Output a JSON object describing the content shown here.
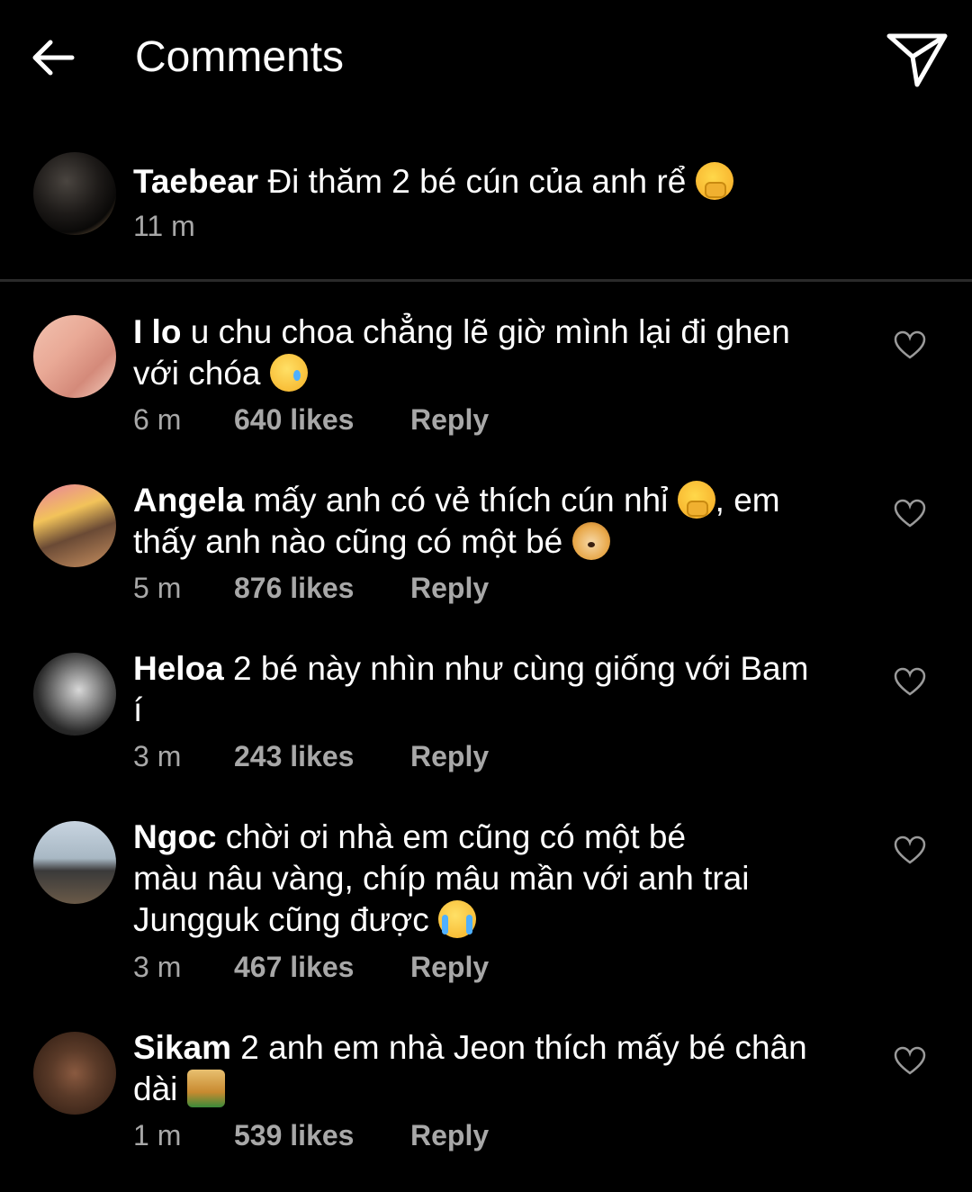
{
  "header": {
    "title": "Comments"
  },
  "caption": {
    "username": "Taebear",
    "text": "Đi thăm 2 bé cún của anh rể",
    "time": "11 m"
  },
  "comments": [
    {
      "username": "I lo",
      "text_line1": "u chu choa chẳng lẽ giờ mình lại đi ghen",
      "text_line2": "với chóa",
      "time": "6 m",
      "likes": "640 likes",
      "reply": "Reply"
    },
    {
      "username": "Angela",
      "text_line1": "mấy anh có vẻ thích cún nhỉ",
      "text_line1b": ", em",
      "text_line2": "thấy anh nào cũng có một bé",
      "time": "5 m",
      "likes": "876 likes",
      "reply": "Reply"
    },
    {
      "username": "Heloa",
      "text_line1": "2 bé này nhìn như cùng giống với Bam",
      "text_line2": "í",
      "time": "3 m",
      "likes": "243 likes",
      "reply": "Reply"
    },
    {
      "username": "Ngoc",
      "text_line1": "chời ơi nhà em cũng có một bé",
      "text_line2": "màu nâu vàng, chíp mâu mần với anh trai",
      "text_line3": "Jungguk cũng được",
      "time": "3 m",
      "likes": "467 likes",
      "reply": "Reply"
    },
    {
      "username": "Sikam",
      "text_line1": "2 anh em nhà Jeon thích mấy bé chân",
      "text_line2": "dài",
      "time": "1 m",
      "likes": "539 likes",
      "reply": "Reply"
    }
  ],
  "icons": [
    "back-arrow-icon",
    "send-icon",
    "heart-icon",
    "emoji-shy-icon",
    "emoji-tear-smile-icon",
    "emoji-dog-icon",
    "emoji-crying-icon",
    "emoji-guide-dog-icon"
  ],
  "colors": {
    "background": "#000000",
    "text": "#ffffff",
    "secondary": "#a8a8a8",
    "divider": "#2a2a2a"
  }
}
